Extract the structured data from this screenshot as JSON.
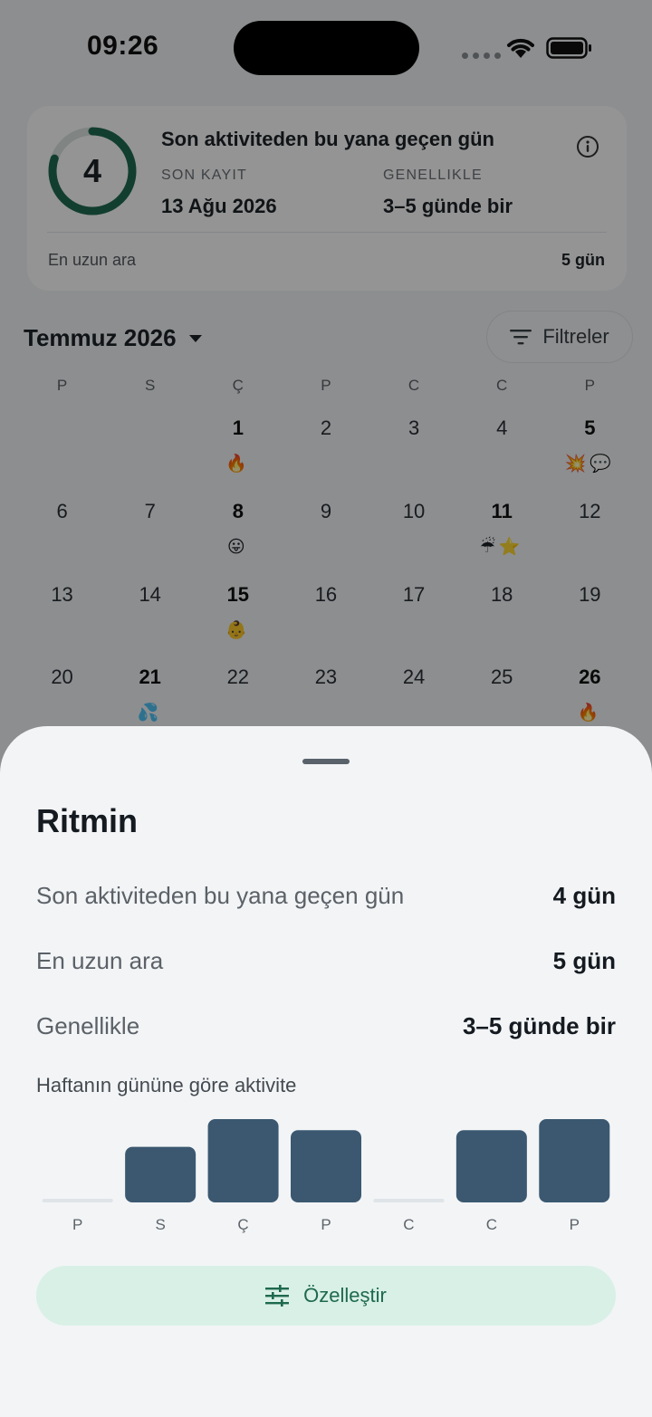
{
  "status_bar": {
    "time": "09:26"
  },
  "summary": {
    "days_since": "4",
    "ring_progress": 0.8,
    "title": "Son aktiviteden bu yana geçen gün",
    "last_record_label": "SON KAYIT",
    "last_record_value": "13 Ağu 2026",
    "usually_label": "GENELLIKLE",
    "usually_value": "3–5 günde bir",
    "longest_label": "En uzun ara",
    "longest_value": "5 gün"
  },
  "calendar": {
    "month": "Temmuz 2026",
    "filter_label": "Filtreler",
    "weekdays": [
      "P",
      "S",
      "Ç",
      "P",
      "C",
      "C",
      "P"
    ],
    "weeks": [
      [
        {
          "day": "",
          "emoji": ""
        },
        {
          "day": "",
          "emoji": ""
        },
        {
          "day": "1",
          "bold": true,
          "emoji": "🔥"
        },
        {
          "day": "2",
          "emoji": ""
        },
        {
          "day": "3",
          "emoji": ""
        },
        {
          "day": "4",
          "emoji": ""
        },
        {
          "day": "5",
          "bold": true,
          "emoji": "💥💬"
        }
      ],
      [
        {
          "day": "6",
          "emoji": ""
        },
        {
          "day": "7",
          "emoji": ""
        },
        {
          "day": "8",
          "bold": true,
          "emoji": "😛"
        },
        {
          "day": "9",
          "emoji": ""
        },
        {
          "day": "10",
          "emoji": ""
        },
        {
          "day": "11",
          "bold": true,
          "emoji": "☔⭐"
        },
        {
          "day": "12",
          "emoji": ""
        }
      ],
      [
        {
          "day": "13",
          "emoji": ""
        },
        {
          "day": "14",
          "emoji": ""
        },
        {
          "day": "15",
          "bold": true,
          "emoji": "👶"
        },
        {
          "day": "16",
          "emoji": ""
        },
        {
          "day": "17",
          "emoji": ""
        },
        {
          "day": "18",
          "emoji": ""
        },
        {
          "day": "19",
          "emoji": ""
        }
      ],
      [
        {
          "day": "20",
          "emoji": ""
        },
        {
          "day": "21",
          "bold": true,
          "emoji": "💦"
        },
        {
          "day": "22",
          "emoji": ""
        },
        {
          "day": "23",
          "emoji": ""
        },
        {
          "day": "24",
          "emoji": ""
        },
        {
          "day": "25",
          "emoji": ""
        },
        {
          "day": "26",
          "bold": true,
          "emoji": "🔥"
        }
      ]
    ]
  },
  "sheet": {
    "title": "Ritmin",
    "rows": [
      {
        "label": "Son aktiviteden bu yana geçen gün",
        "value": "4 gün"
      },
      {
        "label": "En uzun ara",
        "value": "5 gün"
      },
      {
        "label": "Genellikle",
        "value": "3–5 günde bir"
      }
    ],
    "chart_title": "Haftanın gününe göre aktivite",
    "customize_label": "Özelleştir"
  },
  "chart_data": {
    "type": "bar",
    "title": "Haftanın gününe göre aktivite",
    "categories": [
      "P",
      "S",
      "Ç",
      "P",
      "C",
      "C",
      "P"
    ],
    "values": [
      0,
      2,
      3,
      2.6,
      0,
      2.6,
      3
    ],
    "ylim": [
      0,
      3
    ],
    "color": "#3b5870",
    "empty_color": "#dfe4e8"
  },
  "colors": {
    "accent": "#1e6a4e",
    "ring": "#1f6b54",
    "bar": "#3b5870"
  }
}
